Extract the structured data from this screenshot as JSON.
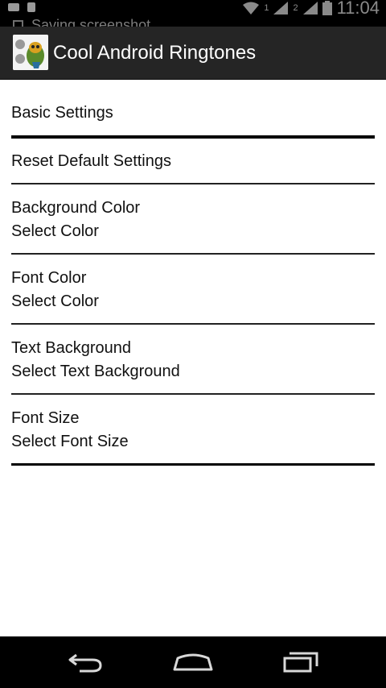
{
  "status_bar": {
    "notification": "Saving screenshot...",
    "time": "11:04",
    "sim1": "1",
    "sim2": "2"
  },
  "action_bar": {
    "title": "Cool Android Ringtones",
    "icon": "app-launcher-icon"
  },
  "settings": {
    "header": "Basic Settings",
    "reset": "Reset Default Settings",
    "background_color": {
      "title": "Background Color",
      "summary": "Select Color"
    },
    "font_color": {
      "title": "Font Color",
      "summary": "Select Color"
    },
    "text_background": {
      "title": "Text Background",
      "summary": "Select Text Background"
    },
    "font_size": {
      "title": "Font Size",
      "summary": "Select Font Size"
    }
  },
  "nav_bar": {
    "back": "back-icon",
    "home": "home-icon",
    "recents": "recents-icon"
  }
}
